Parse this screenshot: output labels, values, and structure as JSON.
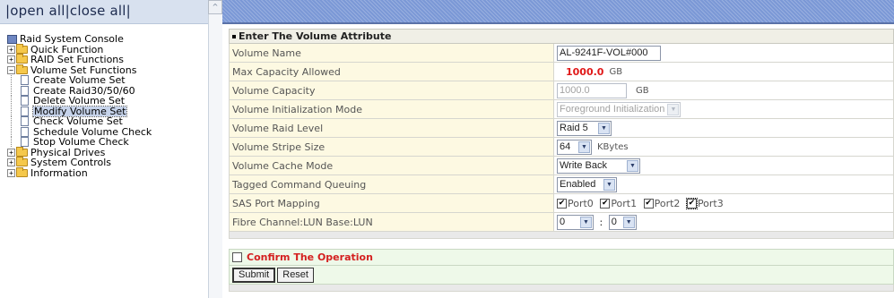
{
  "tree_frame": {
    "open_all": "open all",
    "close_all": "close all",
    "sep": "|",
    "root": "Raid System Console",
    "items": [
      {
        "label": "Quick Function",
        "expanded": false
      },
      {
        "label": "RAID Set Functions",
        "expanded": false
      },
      {
        "label": "Volume Set Functions",
        "expanded": true,
        "children": [
          "Create Volume Set",
          "Create Raid30/50/60",
          "Delete Volume Set",
          "Modify Volume Set",
          "Check Volume Set",
          "Schedule Volume Check",
          "Stop Volume Check"
        ],
        "selected_child": "Modify Volume Set"
      },
      {
        "label": "Physical Drives",
        "expanded": false
      },
      {
        "label": "System Controls",
        "expanded": false
      },
      {
        "label": "Information",
        "expanded": false
      }
    ],
    "expand_symbol": "+",
    "collapse_symbol": "−",
    "scroll_up_symbol": "^"
  },
  "form": {
    "section_title": "Enter The Volume Attribute",
    "rows": {
      "volume_name": {
        "label": "Volume Name",
        "value": "AL-9241F-VOL#000"
      },
      "max_capacity": {
        "label": "Max Capacity Allowed",
        "value": "1000.0",
        "unit": "GB"
      },
      "volume_capacity": {
        "label": "Volume Capacity",
        "value": "1000.0",
        "unit": "GB"
      },
      "init_mode": {
        "label": "Volume Initialization Mode",
        "value": "Foreground Initialization"
      },
      "raid_level": {
        "label": "Volume Raid Level",
        "value": "Raid 5"
      },
      "stripe_size": {
        "label": "Volume Stripe Size",
        "value": "64",
        "unit": "KBytes"
      },
      "cache_mode": {
        "label": "Volume Cache Mode",
        "value": "Write Back"
      },
      "tcq": {
        "label": "Tagged Command Queuing",
        "value": "Enabled"
      },
      "sas_port": {
        "label": "SAS Port Mapping",
        "ports": [
          "Port0",
          "Port1",
          "Port2",
          "Port3"
        ]
      },
      "fibre_lun": {
        "label": "Fibre Channel:LUN Base:LUN",
        "base": "0",
        "sep": ":",
        "lun": "0"
      }
    },
    "confirm_label": "Confirm The Operation",
    "submit_label": "Submit",
    "reset_label": "Reset",
    "dropdown_arrow": "▼",
    "check_mark": "✔"
  },
  "colors": {
    "accent_red": "#e01818",
    "header_blue": "#7b98d6",
    "label_bg": "#fdf9e2",
    "confirm_bg": "#eef9e9"
  }
}
